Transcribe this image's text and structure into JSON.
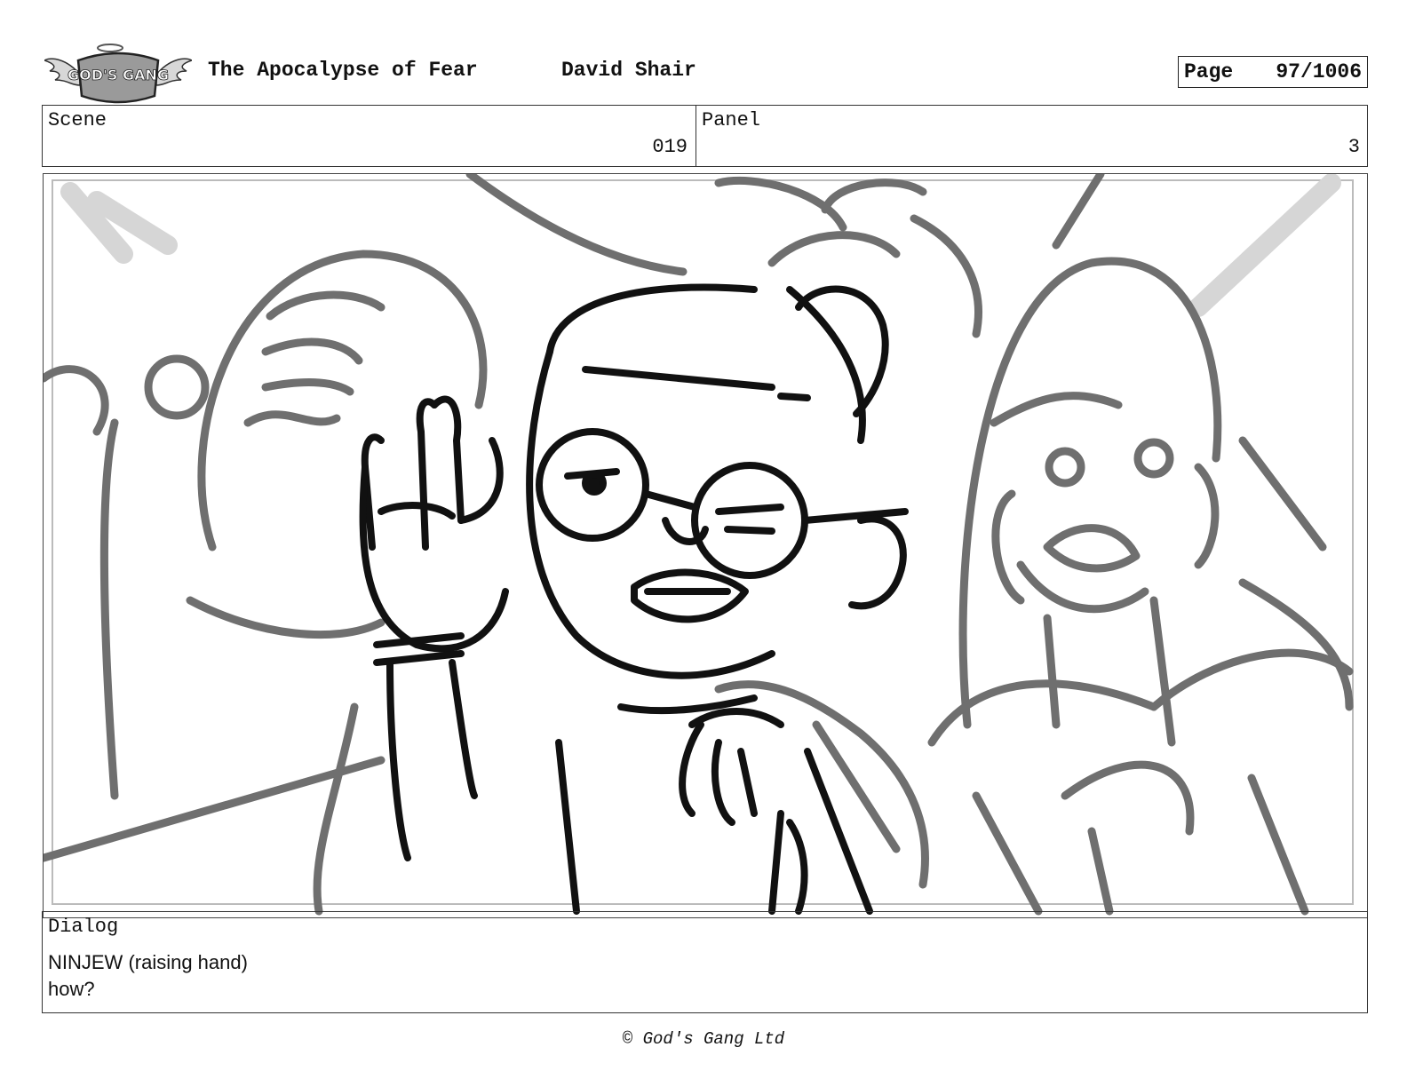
{
  "header": {
    "logo_text": "GOD'S GANG",
    "title": "The Apocalypse of Fear",
    "author": "David Shair",
    "page_label": "Page",
    "page_value": "97/1006"
  },
  "scene": {
    "label": "Scene",
    "value": "019"
  },
  "panel": {
    "label": "Panel",
    "value": "3"
  },
  "dialog": {
    "label": "Dialog",
    "line1": "NINJEW (raising hand)",
    "line2": "how?"
  },
  "footer": {
    "copyright": "© God's Gang Ltd"
  }
}
